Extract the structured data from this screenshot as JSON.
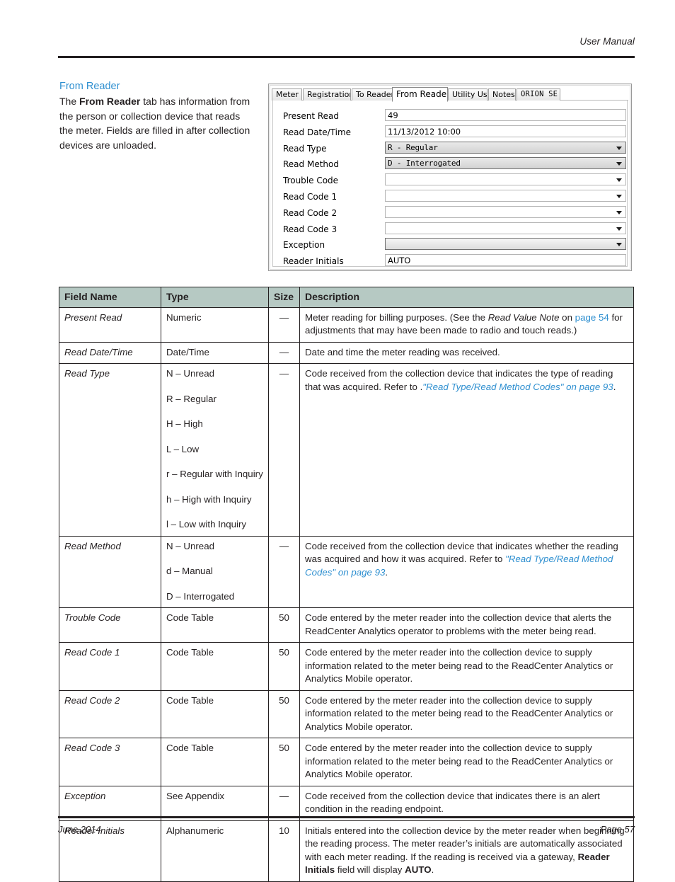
{
  "header": {
    "title": "User Manual"
  },
  "footer": {
    "date": "June 2014",
    "page": "Page 57"
  },
  "intro": {
    "heading": "From Reader",
    "text_part1": "The ",
    "text_bold": "From Reader",
    "text_part2": " tab has information from the person or collection device that reads the meter. Fields are filled in after collection devices are unloaded."
  },
  "dialog": {
    "tabs": [
      {
        "label": "Meter",
        "selected": false
      },
      {
        "label": "Registration",
        "selected": false
      },
      {
        "label": "To Reader",
        "selected": false
      },
      {
        "label": "From Reader",
        "selected": true
      },
      {
        "label": "Utility Use",
        "selected": false
      },
      {
        "label": "Notes",
        "selected": false
      },
      {
        "label": "ORION SE",
        "selected": false
      }
    ],
    "fields": [
      {
        "label": "Present Read",
        "control": "textbox",
        "value": "49"
      },
      {
        "label": "Read Date/Time",
        "control": "textbox",
        "value": "11/13/2012 10:00"
      },
      {
        "label": "Read Type",
        "control": "combo-filled",
        "value": "R - Regular"
      },
      {
        "label": "Read Method",
        "control": "combo-filled",
        "value": "D - Interrogated"
      },
      {
        "label": "Trouble Code",
        "control": "combo-empty",
        "value": ""
      },
      {
        "label": "Read Code 1",
        "control": "combo-empty",
        "value": ""
      },
      {
        "label": "Read Code 2",
        "control": "combo-empty",
        "value": ""
      },
      {
        "label": "Read Code 3",
        "control": "combo-empty",
        "value": ""
      },
      {
        "label": "Exception",
        "control": "combo-grey",
        "value": ""
      },
      {
        "label": "Reader Initials",
        "control": "textbox",
        "value": "AUTO"
      }
    ]
  },
  "table": {
    "headers": [
      "Field Name",
      "Type",
      "Size",
      "Description"
    ],
    "rows": [
      {
        "field": "Present Read",
        "types": [
          "Numeric"
        ],
        "size": "—",
        "desc_segments": [
          {
            "t": "Meter reading for billing purposes. (See the ",
            "s": "plain"
          },
          {
            "t": "Read Value Note",
            "s": "italic"
          },
          {
            "t": " on ",
            "s": "plain"
          },
          {
            "t": "page 54",
            "s": "link"
          },
          {
            "t": " for adjustments that may have been made to radio and touch reads.)",
            "s": "plain"
          }
        ]
      },
      {
        "field": "Read Date/Time",
        "types": [
          "Date/Time"
        ],
        "size": "—",
        "desc_segments": [
          {
            "t": "Date and time the meter reading was received.",
            "s": "plain"
          }
        ]
      },
      {
        "field": "Read Type",
        "types": [
          "N – Unread",
          "R – Regular",
          "H – High",
          "L – Low",
          "r – Regular with Inquiry",
          "h – High with Inquiry",
          "l – Low with Inquiry"
        ],
        "size": "—",
        "desc_segments": [
          {
            "t": "Code received from the collection device that indicates the type of reading that was acquired. Refer to .",
            "s": "plain"
          },
          {
            "t": "\"Read Type/Read Method Codes\" on page 93",
            "s": "link-italic"
          },
          {
            "t": ".",
            "s": "plain"
          }
        ]
      },
      {
        "field": "Read Method",
        "types": [
          "N – Unread",
          "d – Manual",
          "D – Interrogated"
        ],
        "size": "—",
        "desc_segments": [
          {
            "t": "Code received from the collection device that indicates whether the reading was acquired and how it was acquired. Refer to ",
            "s": "plain"
          },
          {
            "t": "\"Read Type/Read Method Codes\" on page 93",
            "s": "link-italic"
          },
          {
            "t": ".",
            "s": "plain"
          }
        ]
      },
      {
        "field": "Trouble Code",
        "types": [
          "Code Table"
        ],
        "size": "50",
        "desc_segments": [
          {
            "t": "Code entered by the meter reader into the collection device that alerts the ReadCenter Analytics operator to problems with the meter being read.",
            "s": "plain"
          }
        ]
      },
      {
        "field": "Read Code 1",
        "types": [
          "Code Table"
        ],
        "size": "50",
        "desc_segments": [
          {
            "t": "Code entered by the meter reader into the collection device to supply information related to the meter being read to the ReadCenter Analytics or Analytics Mobile operator.",
            "s": "plain"
          }
        ]
      },
      {
        "field": "Read Code 2",
        "types": [
          "Code Table"
        ],
        "size": "50",
        "desc_segments": [
          {
            "t": "Code entered by the meter reader into the collection device to supply information related to the meter being read to the ReadCenter Analytics or Analytics Mobile operator.",
            "s": "plain"
          }
        ]
      },
      {
        "field": "Read Code 3",
        "types": [
          "Code Table"
        ],
        "size": "50",
        "desc_segments": [
          {
            "t": "Code entered by the meter reader into the collection device to supply information related to the meter being read to the ReadCenter Analytics or Analytics Mobile operator.",
            "s": "plain"
          }
        ]
      },
      {
        "field": "Exception",
        "types": [
          "See Appendix"
        ],
        "size": "—",
        "desc_segments": [
          {
            "t": "Code received from the collection device that indicates there is an alert condition in the reading endpoint.",
            "s": "plain"
          }
        ]
      },
      {
        "field": "Reader Initials",
        "types": [
          "Alphanumeric"
        ],
        "size": "10",
        "desc_segments": [
          {
            "t": "Initials entered into the collection device by the meter reader when beginning the reading process. The meter reader’s initials are automatically associated with each meter reading. If the reading is received via a gateway, ",
            "s": "plain"
          },
          {
            "t": "Reader Initials",
            "s": "bold"
          },
          {
            "t": " field will display ",
            "s": "plain"
          },
          {
            "t": "AUTO",
            "s": "bold"
          },
          {
            "t": ".",
            "s": "plain"
          }
        ]
      }
    ]
  },
  "colors": {
    "link": "#2e8fd0",
    "table_header_bg": "#b6c9c3",
    "rule": "#231f20"
  }
}
